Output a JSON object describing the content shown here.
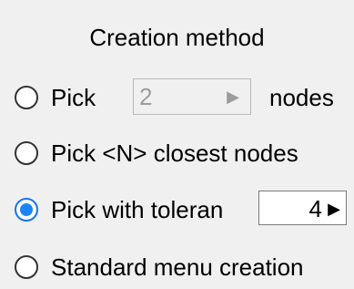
{
  "panel": {
    "title": "Creation method",
    "options": [
      {
        "label": "Pick",
        "selected": false,
        "spinner": {
          "value": "2",
          "arrow": "▶",
          "enabled": false
        },
        "suffix": "nodes"
      },
      {
        "label": "Pick <N> closest nodes",
        "selected": false
      },
      {
        "label": "Pick with toleran",
        "selected": true,
        "spinner": {
          "value": "4",
          "arrow": "▶",
          "enabled": true
        }
      },
      {
        "label": "Standard menu creation",
        "selected": false
      }
    ]
  },
  "colors": {
    "background": "#f0f0f0",
    "radio_selected": "#1a86f5",
    "disabled_text": "#9c9c9c"
  }
}
